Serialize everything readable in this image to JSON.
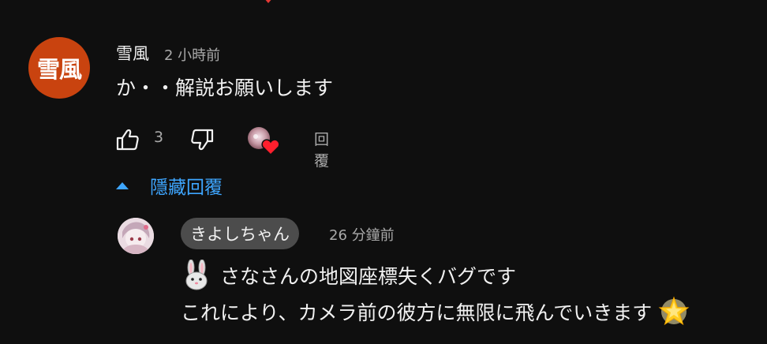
{
  "comment": {
    "author": "雪風",
    "avatar_text": "雪風",
    "avatar_color": "#c9430f",
    "time": "2 小時前",
    "text": "か・・解説お願いします",
    "like_count": "3",
    "reply_label": "回覆",
    "icons": [
      "thumb-up-icon",
      "thumb-down-icon",
      "creator-heart-icon"
    ]
  },
  "replies_toggle": {
    "label": "隱藏回覆",
    "color": "#3ea6ff"
  },
  "reply": {
    "author": "きよしちゃん",
    "time": "26 分鐘前",
    "line1": "さなさんの地図座標失くバグです",
    "line2": "これにより、カメラ前の彼方に無限に飛んでいきます",
    "emojis": [
      "rabbit-face-emoji",
      "glowing-star-emoji"
    ]
  }
}
